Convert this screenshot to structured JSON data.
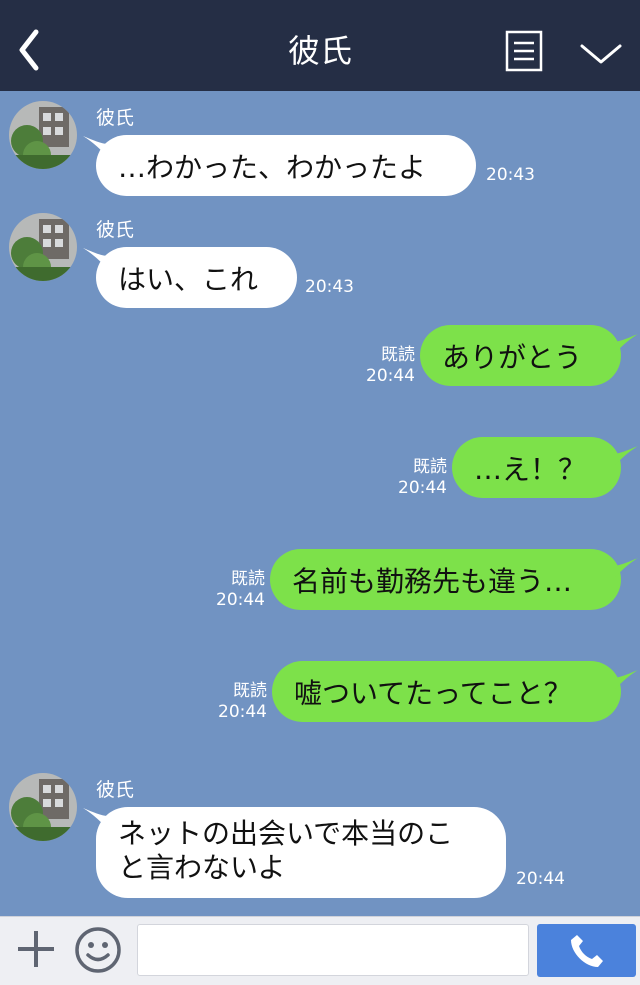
{
  "header": {
    "title": "彼氏"
  },
  "messages": [
    {
      "side": "in",
      "sender": "彼氏",
      "text": "…わかった、わかったよ",
      "time": "20:43"
    },
    {
      "side": "in",
      "sender": "彼氏",
      "text": "はい、これ",
      "time": "20:43"
    },
    {
      "side": "out",
      "read": "既読",
      "text": "ありがとう",
      "time": "20:44"
    },
    {
      "side": "out",
      "read": "既読",
      "text": "…え！？",
      "time": "20:44"
    },
    {
      "side": "out",
      "read": "既読",
      "text": "名前も勤務先も違う…",
      "time": "20:44"
    },
    {
      "side": "out",
      "read": "既読",
      "text": "嘘ついてたってこと？",
      "time": "20:44"
    },
    {
      "side": "in",
      "sender": "彼氏",
      "text_line1": "ネットの出会いで本当のこ",
      "text_line2": "と言わないよ",
      "time": "20:44"
    }
  ],
  "footer": {
    "input_placeholder": ""
  },
  "colors": {
    "header_bg": "#252e45",
    "chat_bg": "#7193c2",
    "outgoing_bubble": "#7de14a",
    "incoming_bubble": "#ffffff",
    "call_button": "#4b82dc"
  },
  "icons": [
    "back-arrow-icon",
    "menu-list-icon",
    "chevron-down-icon",
    "plus-icon",
    "emoji-icon",
    "phone-icon"
  ]
}
